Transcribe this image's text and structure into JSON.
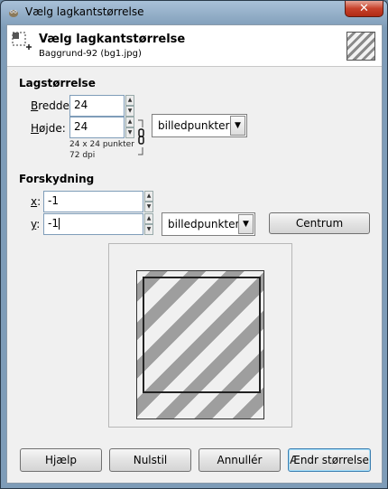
{
  "window": {
    "title": "Vælg lagkantstørrelse",
    "close_glyph": "✕"
  },
  "header": {
    "title": "Vælg lagkantstørrelse",
    "subtitle": "Baggrund-92 (bg1.jpg)"
  },
  "layer_size": {
    "section_title": "Lagstørrelse",
    "width_label_u": "B",
    "width_label_rest": "redde:",
    "width_value": "24",
    "height_label_u": "H",
    "height_label_rest": "øjde:",
    "height_value": "24",
    "unit": "billedpunkter",
    "info_size": "24 x 24 punkter",
    "info_dpi": "72 dpi"
  },
  "offset": {
    "section_title": "Forskydning",
    "x_label_u": "x",
    "x_label_rest": ":",
    "x_value": "-1",
    "y_label_u": "y",
    "y_label_rest": ":",
    "y_value": "-1",
    "unit": "billedpunkter",
    "center_button": "Centrum"
  },
  "buttons": {
    "help": "Hjælp",
    "reset": "Nulstil",
    "cancel": "Annullér",
    "resize": "Ændr størrelse"
  },
  "icons": {
    "app": "gimp-wilber-icon",
    "header": "layer-resize-icon",
    "chain": "chain-link-icon",
    "spin_up": "▲",
    "spin_down": "▼",
    "dropdown": "▼"
  }
}
